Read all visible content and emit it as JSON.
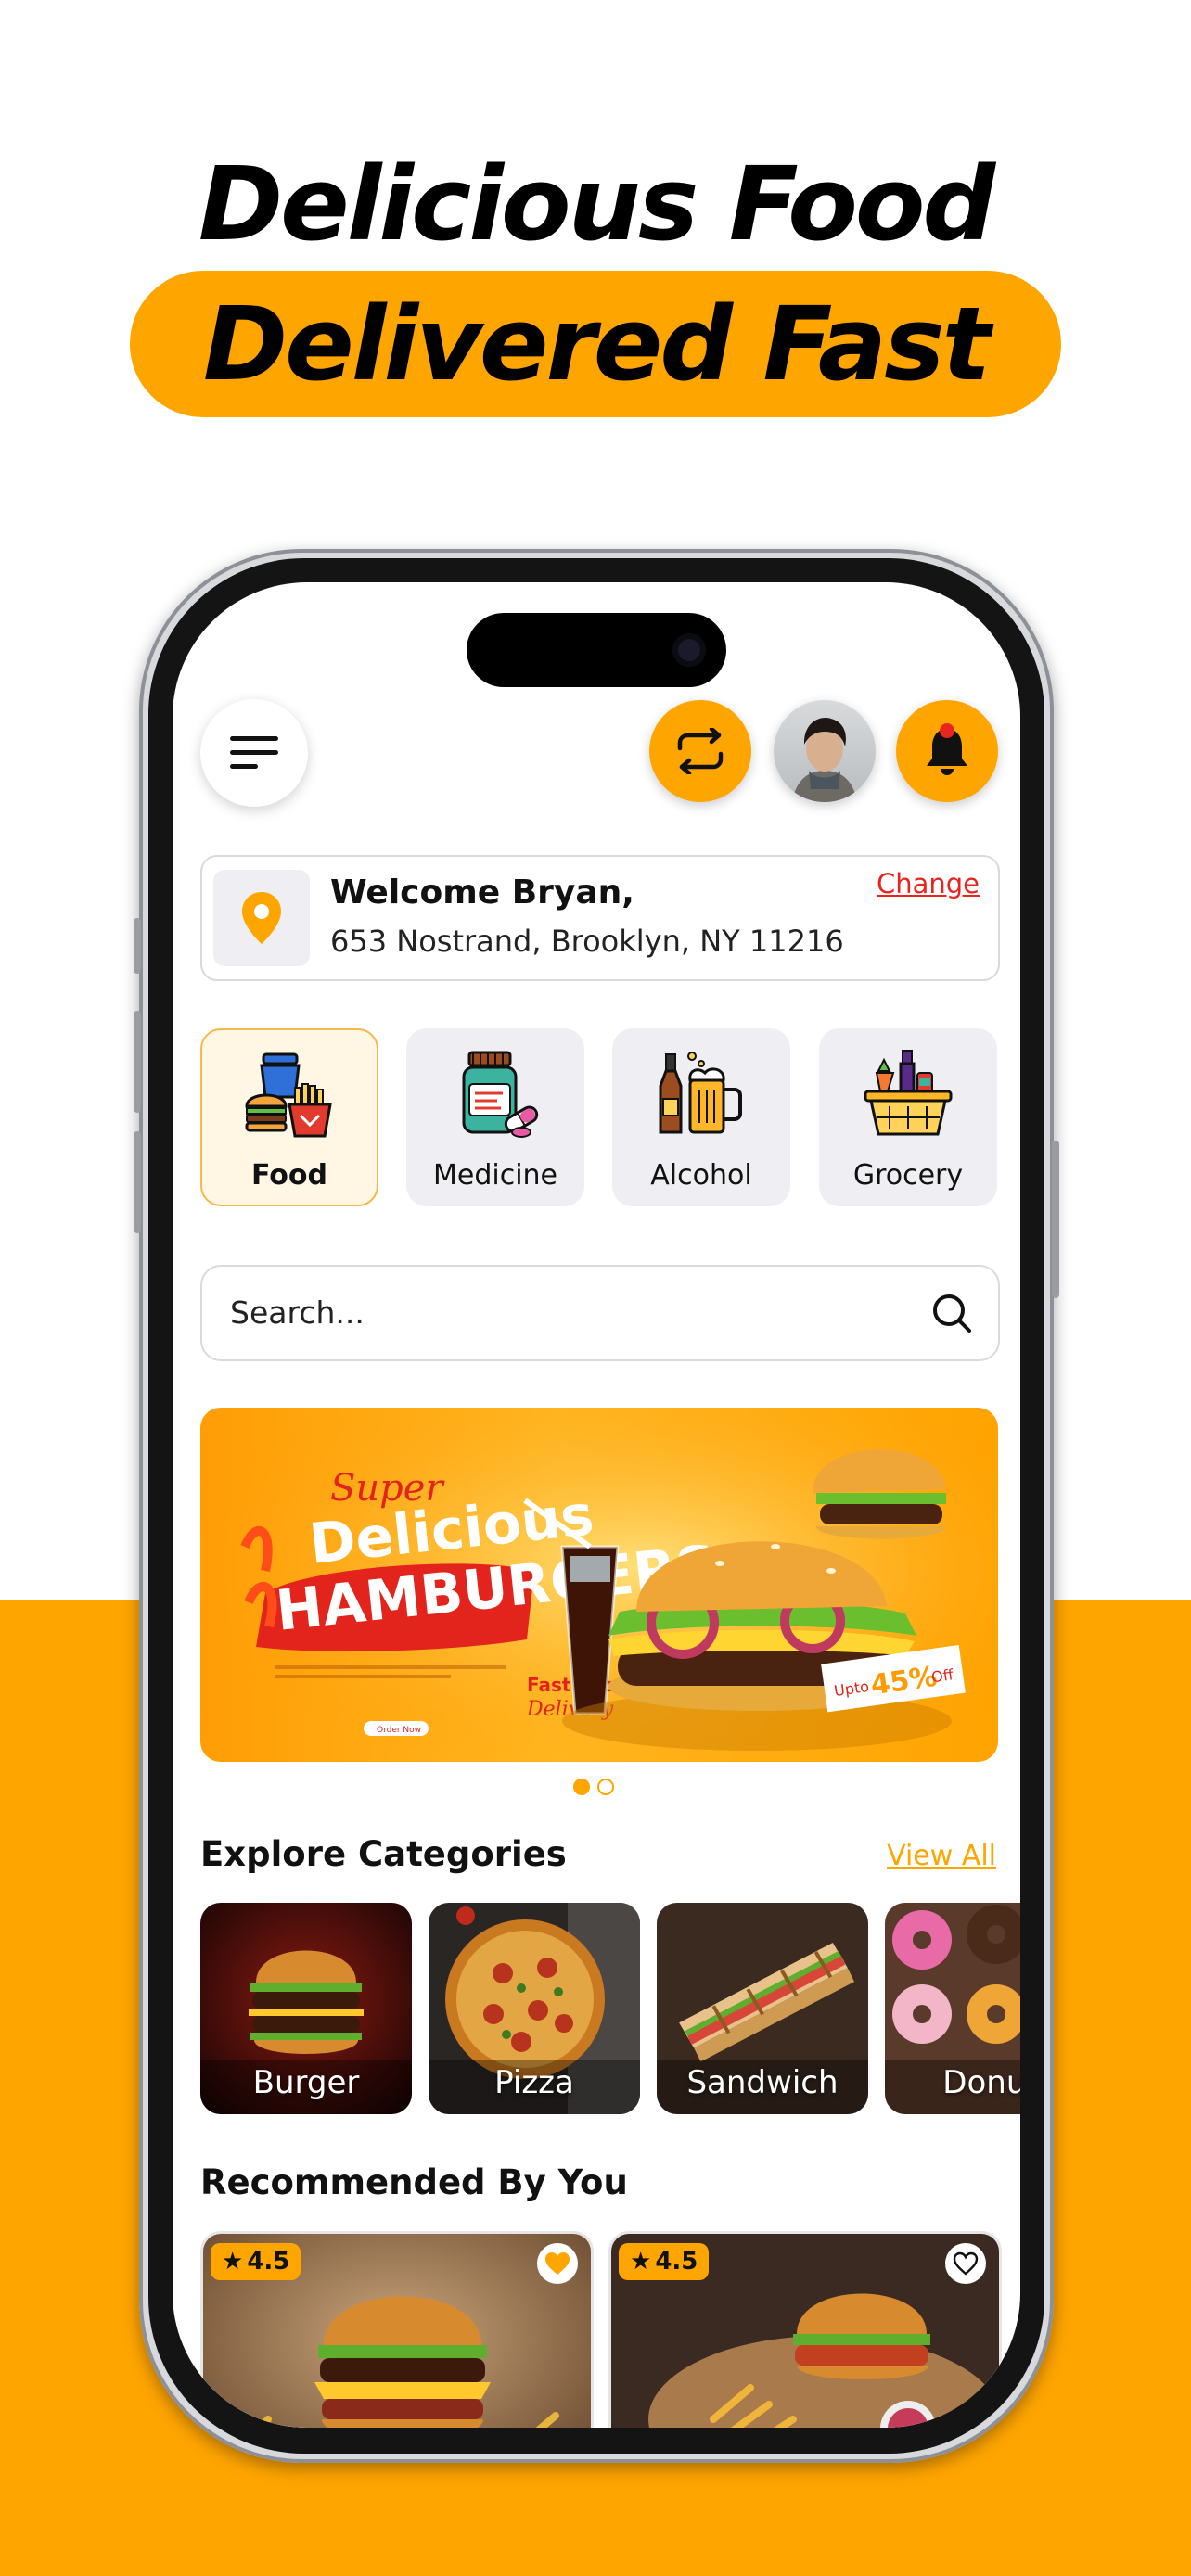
{
  "headline": {
    "line1": "Delicious Food",
    "line2": "Delivered Fast"
  },
  "colors": {
    "accent": "#ffa500",
    "link_red": "#e8261f"
  },
  "header": {
    "menu_icon": "hamburger-menu-icon",
    "swap_icon": "swap-arrows-icon",
    "notification_icon": "bell-icon"
  },
  "location": {
    "welcome": "Welcome Bryan,",
    "address": "653 Nostrand, Brooklyn, NY 11216",
    "change_label": "Change",
    "icon": "location-pin-icon"
  },
  "service_categories": [
    {
      "label": "Food",
      "selected": true
    },
    {
      "label": "Medicine",
      "selected": false
    },
    {
      "label": "Alcohol",
      "selected": false
    },
    {
      "label": "Grocery",
      "selected": false
    }
  ],
  "search": {
    "placeholder": "Search..."
  },
  "banner": {
    "script_text": "Super",
    "title_line1": "Delicious",
    "title_line2": "HAMBURGERS",
    "offer_prefix": "Upto",
    "offer_value": "45%",
    "offer_suffix": "Off",
    "badge_line1": "Fast Food",
    "badge_line2": "Delivery",
    "cta": "Order Now",
    "slide_count": 2,
    "active_slide": 1
  },
  "explore": {
    "title": "Explore Categories",
    "view_all_label": "View All",
    "items": [
      {
        "label": "Burger"
      },
      {
        "label": "Pizza"
      },
      {
        "label": "Sandwich"
      },
      {
        "label": "Donut"
      }
    ]
  },
  "recommended": {
    "title": "Recommended By You",
    "items": [
      {
        "rating": "4.5",
        "favorite": true
      },
      {
        "rating": "4.5",
        "favorite": false
      }
    ]
  }
}
